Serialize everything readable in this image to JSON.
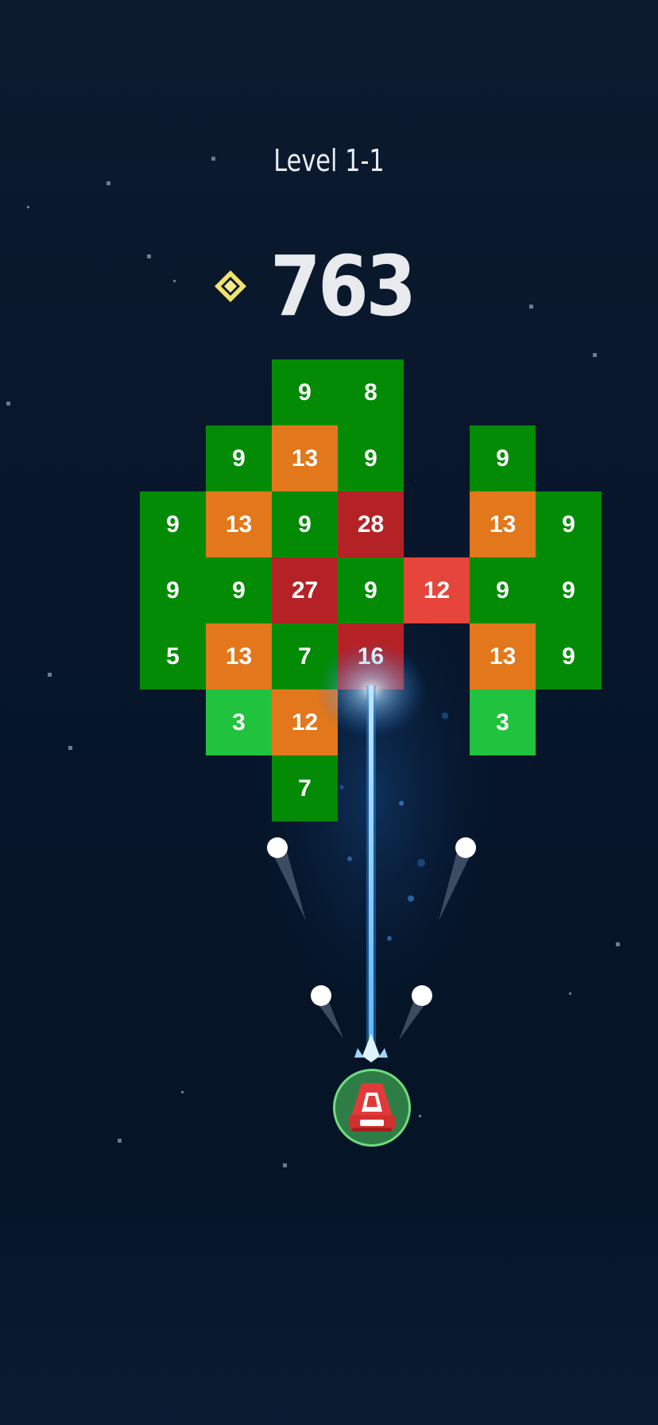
{
  "level": {
    "title": "Level 1-1"
  },
  "score": {
    "value": "763",
    "icon": "diamond-gem-icon",
    "icon_color": "#f3e36a"
  },
  "colors": {
    "background": "#07162b",
    "green_dark": "#038b06",
    "green_light": "#21c23e",
    "orange": "#e2771b",
    "red": "#b52226",
    "red_light": "#e5453a",
    "laser": "#3fb0ff",
    "ship_base": "#2e7d46",
    "ship_body": "#e23a3a"
  },
  "blocks": [
    {
      "row": 0,
      "col": 2,
      "value": "9",
      "color": "green_dark"
    },
    {
      "row": 0,
      "col": 3,
      "value": "8",
      "color": "green_dark"
    },
    {
      "row": 1,
      "col": 1,
      "value": "9",
      "color": "green_dark"
    },
    {
      "row": 1,
      "col": 2,
      "value": "13",
      "color": "orange"
    },
    {
      "row": 1,
      "col": 3,
      "value": "9",
      "color": "green_dark"
    },
    {
      "row": 1,
      "col": 5,
      "value": "9",
      "color": "green_dark"
    },
    {
      "row": 2,
      "col": 0,
      "value": "9",
      "color": "green_dark"
    },
    {
      "row": 2,
      "col": 1,
      "value": "13",
      "color": "orange"
    },
    {
      "row": 2,
      "col": 2,
      "value": "9",
      "color": "green_dark"
    },
    {
      "row": 2,
      "col": 3,
      "value": "28",
      "color": "red"
    },
    {
      "row": 2,
      "col": 5,
      "value": "13",
      "color": "orange"
    },
    {
      "row": 2,
      "col": 6,
      "value": "9",
      "color": "green_dark"
    },
    {
      "row": 3,
      "col": 0,
      "value": "9",
      "color": "green_dark"
    },
    {
      "row": 3,
      "col": 1,
      "value": "9",
      "color": "green_dark"
    },
    {
      "row": 3,
      "col": 2,
      "value": "27",
      "color": "red"
    },
    {
      "row": 3,
      "col": 3,
      "value": "9",
      "color": "green_dark"
    },
    {
      "row": 3,
      "col": 4,
      "value": "12",
      "color": "red_light"
    },
    {
      "row": 3,
      "col": 5,
      "value": "9",
      "color": "green_dark"
    },
    {
      "row": 3,
      "col": 6,
      "value": "9",
      "color": "green_dark"
    },
    {
      "row": 4,
      "col": 0,
      "value": "5",
      "color": "green_dark"
    },
    {
      "row": 4,
      "col": 1,
      "value": "13",
      "color": "orange"
    },
    {
      "row": 4,
      "col": 2,
      "value": "7",
      "color": "green_dark"
    },
    {
      "row": 4,
      "col": 3,
      "value": "16",
      "color": "red"
    },
    {
      "row": 4,
      "col": 5,
      "value": "13",
      "color": "orange"
    },
    {
      "row": 4,
      "col": 6,
      "value": "9",
      "color": "green_dark"
    },
    {
      "row": 5,
      "col": 1,
      "value": "3",
      "color": "green_light"
    },
    {
      "row": 5,
      "col": 2,
      "value": "12",
      "color": "orange"
    },
    {
      "row": 5,
      "col": 5,
      "value": "3",
      "color": "green_light"
    },
    {
      "row": 6,
      "col": 2,
      "value": "7",
      "color": "green_dark"
    }
  ],
  "player": {
    "icon": "spaceship-icon"
  }
}
